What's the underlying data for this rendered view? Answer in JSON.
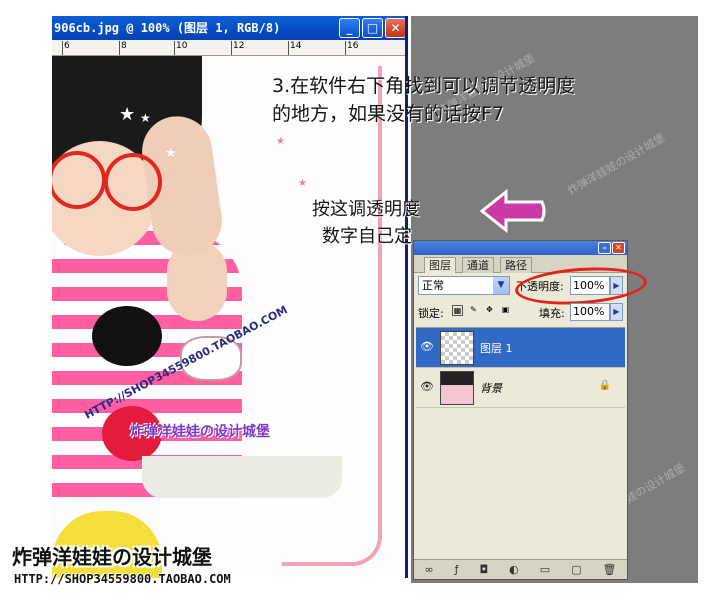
{
  "document": {
    "title": "906cb.jpg @ 100% (图层 1, RGB/8)",
    "ruler_labels": [
      "6",
      "8",
      "10",
      "12",
      "14",
      "16"
    ],
    "canvas_url_text": "HTTP://SHOP34559800.TAOBAO.COM",
    "canvas_brand_text": "炸弹洋娃娃の设计城堡"
  },
  "annotations": {
    "main_line1": "3.在软件右下角找到可以调节透明度",
    "main_line2": "的地方，如果没有的话按F7",
    "opacity_line1": "按这调透明度",
    "opacity_line2": "数字自己定"
  },
  "layers_panel": {
    "tabs": [
      "图层",
      "通道",
      "路径"
    ],
    "blend_mode": "正常",
    "opacity_label": "不透明度:",
    "opacity_value": "100%",
    "lock_label": "锁定:",
    "fill_label": "填充:",
    "fill_value": "100%",
    "layers": [
      {
        "name": "图层 1",
        "selected": true
      },
      {
        "name": "背景",
        "selected": false
      }
    ]
  },
  "brand": {
    "title": "炸弹洋娃娃の设计城堡",
    "url": "HTTP://SHOP34559800.TAOBAO.COM"
  },
  "colors": {
    "titlebar": "#0a5ed8",
    "selected_layer": "#3169c6",
    "highlight_circle": "#e2221b",
    "arrow": "#cc3aa8"
  }
}
